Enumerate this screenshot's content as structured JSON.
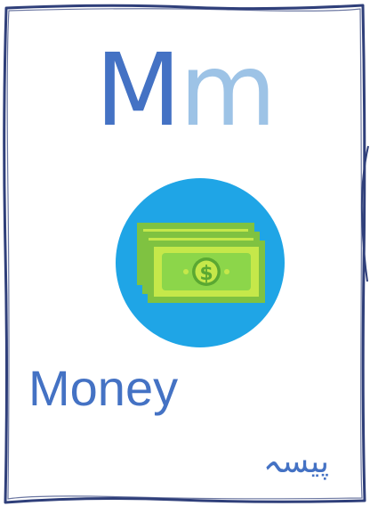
{
  "card": {
    "letter_upper": "M",
    "letter_lower": "m",
    "word": "Money",
    "translation": "پیسہ",
    "icon": "money-cash-icon",
    "colors": {
      "border": "#2f3f7a",
      "upper_letter": "#4472c4",
      "lower_letter": "#9dc3e6",
      "word": "#4472c4",
      "icon_circle": "#1fa5e6",
      "bill_dark": "#7fc241",
      "bill_light": "#c5e84a",
      "bill_center": "#8cd64a"
    }
  }
}
